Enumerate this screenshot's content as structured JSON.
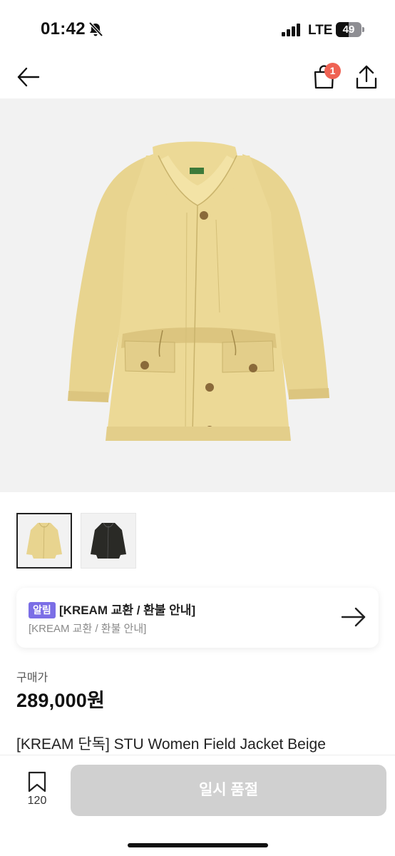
{
  "status_bar": {
    "time": "01:42",
    "network": "LTE",
    "battery": "49",
    "battery_level": 0.49,
    "icons": [
      "bell-off-icon",
      "signal-icon",
      "battery-icon"
    ]
  },
  "nav": {
    "back_icon": "arrow-left-icon",
    "cart_icon": "shopping-bag-icon",
    "cart_badge": "1",
    "share_icon": "share-icon"
  },
  "gallery": {
    "thumbnails": [
      {
        "color": "beige",
        "selected": true
      },
      {
        "color": "black",
        "selected": false
      }
    ]
  },
  "notice": {
    "tag": "알림",
    "title": "[KREAM 교환 / 환불 안내]",
    "subtitle": "[KREAM 교환 / 환불 안내]",
    "arrow_icon": "arrow-right-icon"
  },
  "product": {
    "price_label": "구매가",
    "price": "289,000원",
    "name": "[KREAM 단독] STU Women Field Jacket Beige"
  },
  "bottom_bar": {
    "bookmark_icon": "bookmark-icon",
    "bookmark_count": "120",
    "buy_button": "일시 품절"
  },
  "colors": {
    "badge": "#ef6253",
    "notice_tag": "#7b6ee6",
    "disabled_button": "#d0d0d0",
    "image_background": "#f2f2f2"
  }
}
